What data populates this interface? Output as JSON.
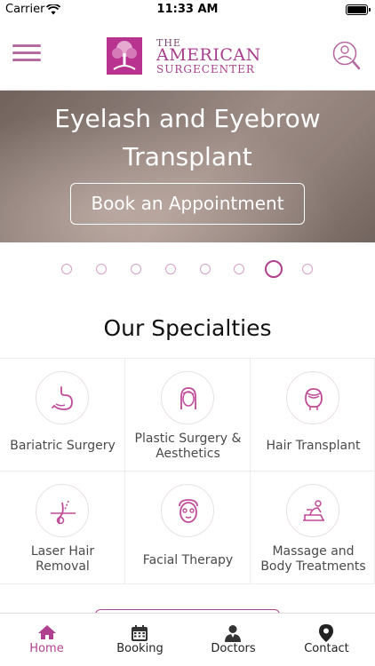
{
  "status_bar": {
    "carrier": "Carrier",
    "time": "11:33 AM"
  },
  "header": {
    "logo": {
      "the": "THE",
      "american": "AMERICAN",
      "surgecenter": "SURGECENTER"
    },
    "menu_icon": "hamburger-menu-icon",
    "search_icon": "doctor-search-icon"
  },
  "banner": {
    "title_line1": "Eyelash and Eyebrow",
    "title_line2": "Transplant",
    "button_label": "Book an Appointment"
  },
  "carousel": {
    "slide_count": 8,
    "active_index": 6
  },
  "specialties": {
    "title": "Our Specialties",
    "items": [
      {
        "label_line1": "Bariatric Surgery",
        "label_line2": "",
        "icon": "stomach-icon"
      },
      {
        "label_line1": "Plastic Surgery &",
        "label_line2": "Aesthetics",
        "icon": "woman-face-icon"
      },
      {
        "label_line1": "Hair Transplant",
        "label_line2": "",
        "icon": "head-hair-icon"
      },
      {
        "label_line1": "Laser Hair",
        "label_line2": "Removal",
        "icon": "hair-follicle-icon"
      },
      {
        "label_line1": "Facial Therapy",
        "label_line2": "",
        "icon": "face-mask-icon"
      },
      {
        "label_line1": "Massage and",
        "label_line2": "Body Treatments",
        "icon": "massage-icon"
      }
    ]
  },
  "tabbar": {
    "tabs": [
      {
        "label": "Home",
        "icon": "home-icon",
        "active": true
      },
      {
        "label": "Booking",
        "icon": "calendar-icon",
        "active": false
      },
      {
        "label": "Doctors",
        "icon": "doctor-icon",
        "active": false
      },
      {
        "label": "Contact",
        "icon": "location-pin-icon",
        "active": false
      }
    ]
  },
  "colors": {
    "brand": "#b0418f",
    "brand_light": "#d49fc6"
  }
}
